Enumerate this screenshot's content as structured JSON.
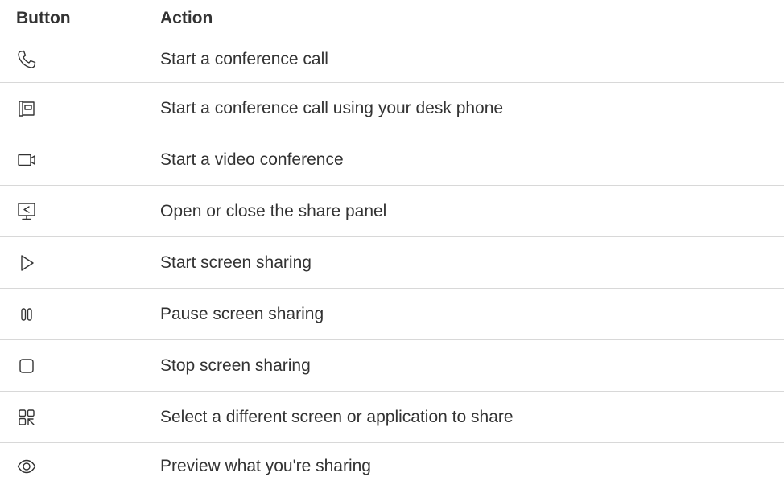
{
  "table": {
    "headers": {
      "button": "Button",
      "action": "Action"
    },
    "rows": [
      {
        "icon": "phone-icon",
        "action": "Start a conference call"
      },
      {
        "icon": "desk-phone-icon",
        "action": "Start a conference call using your desk phone"
      },
      {
        "icon": "video-camera-icon",
        "action": "Start a video conference"
      },
      {
        "icon": "share-screen-icon",
        "action": "Open or close the share panel"
      },
      {
        "icon": "play-icon",
        "action": "Start screen sharing"
      },
      {
        "icon": "pause-icon",
        "action": "Pause screen sharing"
      },
      {
        "icon": "stop-icon",
        "action": "Stop screen sharing"
      },
      {
        "icon": "select-screen-icon",
        "action": "Select a different screen or application to share"
      },
      {
        "icon": "eye-icon",
        "action": "Preview what you're sharing"
      }
    ]
  },
  "colors": {
    "text": "#333333",
    "divider": "#d8d8d8",
    "icon_stroke": "#333333"
  }
}
